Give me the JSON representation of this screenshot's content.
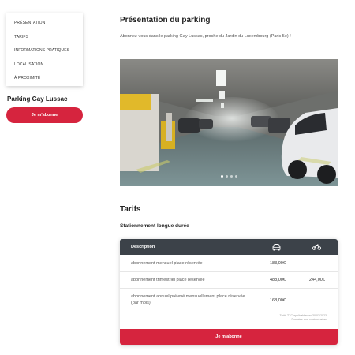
{
  "sidebar": {
    "items": [
      {
        "label": "PRÉSENTATION"
      },
      {
        "label": "TARIFS"
      },
      {
        "label": "INFORMATIONS PRATIQUES"
      },
      {
        "label": "LOCALISATION"
      },
      {
        "label": "À PROXIMITÉ"
      }
    ],
    "parking_name": "Parking Gay Lussac",
    "subscribe_label": "Je m'abonne"
  },
  "presentation": {
    "title": "Présentation du parking",
    "intro": "Abonnez-vous dans le parking Gay Lussac, proche du Jardin du Luxembourg (Paris 5e) !"
  },
  "carousel": {
    "slide_count": 4,
    "active_index": 0
  },
  "tarifs": {
    "title": "Tarifs",
    "subtitle": "Stationnement longue durée",
    "table": {
      "headers": {
        "description": "Description",
        "car_icon": "car-icon",
        "moto_icon": "motorbike-icon"
      },
      "rows": [
        {
          "description": "abonnement mensuel place réservée",
          "car": "183,00€",
          "moto": ""
        },
        {
          "description": "abonnement trimestriel place réservée",
          "car": "488,00€",
          "moto": "244,00€"
        },
        {
          "description": "abonnement annuel prélevé mensuellement place réservée (par mois)",
          "car": "168,00€",
          "moto": ""
        }
      ]
    },
    "footnote_line1": "Tarifs TTC applicables au 30/03/2023",
    "footnote_line2": "Données non contractuelles",
    "subscribe_label": "Je m'abonne"
  },
  "colors": {
    "accent": "#d6243e",
    "table_header": "#3c4249"
  }
}
